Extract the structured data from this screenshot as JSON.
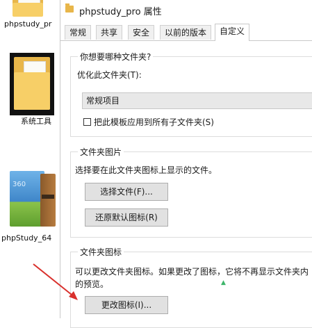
{
  "desktop": {
    "items": [
      {
        "label": "phpstudy_pr"
      },
      {
        "label": "系统工具"
      },
      {
        "label": "phpStudy_64",
        "box_text": "360"
      }
    ]
  },
  "window": {
    "title": "phpstudy_pro 属性",
    "tabs": [
      {
        "label": "常规"
      },
      {
        "label": "共享"
      },
      {
        "label": "安全"
      },
      {
        "label": "以前的版本"
      },
      {
        "label": "自定义",
        "active": true
      }
    ]
  },
  "customize": {
    "optimize_group": {
      "title": "你想要哪种文件夹?",
      "optimize_label": "优化此文件夹(T):",
      "optimize_value": "常规项目",
      "apply_subfolders_label": "把此模板应用到所有子文件夹(S)",
      "apply_subfolders_checked": false
    },
    "picture_group": {
      "title": "文件夹图片",
      "description": "选择要在此文件夹图标上显示的文件。",
      "choose_file_button": "选择文件(F)...",
      "restore_default_button": "还原默认图标(R)"
    },
    "icon_group": {
      "title": "文件夹图标",
      "description_line1": "可以更改文件夹图标。如果更改了图标，它将不再显示文件夹内",
      "description_line2": "的预览。",
      "change_icon_button": "更改图标(I)..."
    }
  },
  "colors": {
    "annotation_arrow": "#d9302c",
    "folder": "#f7cf67"
  }
}
